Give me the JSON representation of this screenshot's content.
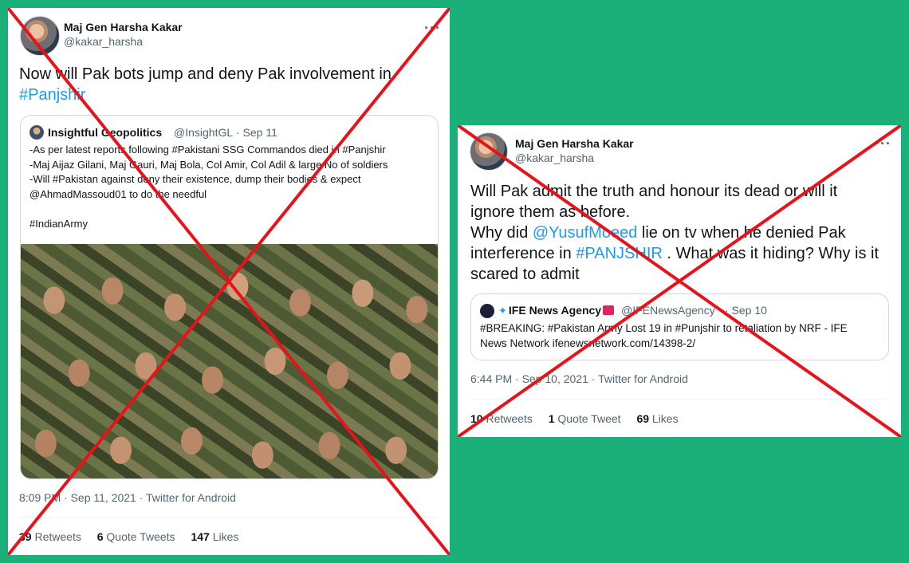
{
  "tweet1": {
    "name": "Maj Gen Harsha Kakar",
    "handle": "@kakar_harsha",
    "more": "···",
    "text_line1": "Now will Pak bots jump and deny Pak involvement in",
    "text_hashtag": "#Panjshir",
    "quote": {
      "name": "Insightful Geopolitics",
      "handle": "@InsightGL",
      "date": "· Sep 11",
      "text": "-As per latest reports following #Pakistani SSG Commandos died in #Panjshir\n-Maj Aijaz Gilani, Maj Gauri, Maj Bola, Col Amir, Col Adil & large No of soldiers\n-Will #Pakistan against deny their existence, dump their bodies & expect @AhmadMassoud01 to do the needful\n\n#IndianArmy"
    },
    "meta": "8:09 PM · Sep 11, 2021 · Twitter for Android",
    "retweets_count": "39",
    "retweets_label": "Retweets",
    "quotes_count": "6",
    "quotes_label": "Quote Tweets",
    "likes_count": "147",
    "likes_label": "Likes"
  },
  "tweet2": {
    "name": "Maj Gen Harsha Kakar",
    "handle": "@kakar_harsha",
    "more": "···",
    "text_a": "Will Pak admit the truth and honour its dead or will it ignore them as before.",
    "text_b": "Why did ",
    "mention": "@YusufMoeed",
    "text_c": " lie on tv when he denied Pak interference in ",
    "hashtag": "#PANJSHIR",
    "text_d": " . What was it hiding? Why is it scared to admit",
    "quote": {
      "name": "IFE News Agency",
      "handle": "@IFENewsAgency",
      "date": "· Sep 10",
      "text": "#BREAKING: #Pakistan Army Lost 19 in #Punjshir to retaliation by NRF - IFE News Network ifenewsnetwork.com/14398-2/"
    },
    "meta": "6:44 PM · Sep 10, 2021 · Twitter for Android",
    "retweets_count": "10",
    "retweets_label": "Retweets",
    "quotes_count": "1",
    "quotes_label": "Quote Tweet",
    "likes_count": "69",
    "likes_label": "Likes"
  },
  "colors": {
    "background": "#1bb07a",
    "link": "#1d9bf0",
    "cross": "#e8121b"
  }
}
